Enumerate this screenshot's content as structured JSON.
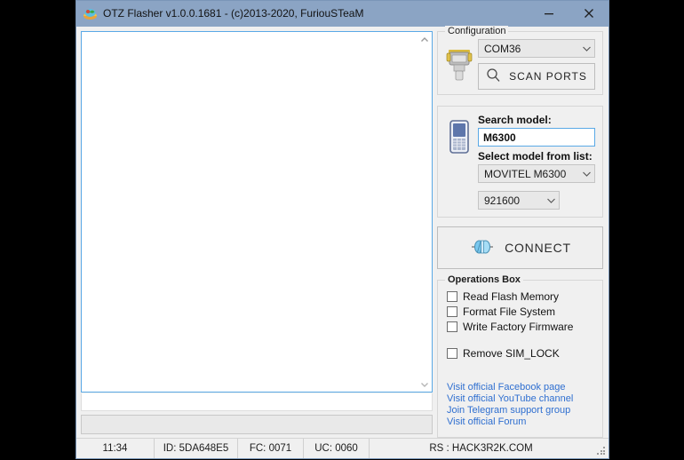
{
  "window": {
    "title": "OTZ Flasher v1.0.0.1681 - (c)2013-2020, FuriouSTeaM",
    "icon": "app-logo-icon",
    "minimize_label": "—",
    "close_label": "✕"
  },
  "log": {
    "text": "",
    "scroll_up": "⌃",
    "scroll_down": "⌄"
  },
  "configuration": {
    "group_title": "Configuration",
    "icon": "serial-port-icon",
    "port": {
      "value": "COM36",
      "options": [
        "COM36"
      ]
    },
    "scan_button": {
      "label": "SCAN PORTS",
      "icon": "magnifier-icon"
    }
  },
  "model": {
    "icon": "mobile-phone-icon",
    "search_label": "Search model:",
    "search_value": "M6300",
    "search_placeholder": "Search model",
    "list_label": "Select model from list:",
    "list_value": "MOVITEL M6300",
    "list_options": [
      "MOVITEL M6300"
    ],
    "baud_value": "921600",
    "baud_options": [
      "921600"
    ]
  },
  "connect": {
    "label": "CONNECT",
    "icon": "cable-plug-icon"
  },
  "operations": {
    "group_title": "Operations Box",
    "items": [
      {
        "label": "Read Flash Memory",
        "checked": false
      },
      {
        "label": "Format File System",
        "checked": false
      },
      {
        "label": "Write Factory Firmware",
        "checked": false
      },
      {
        "label": "Remove SIM_LOCK",
        "checked": false
      }
    ],
    "links": [
      "Visit official Facebook page",
      "Visit official YouTube channel",
      "Join Telegram support group",
      "Visit official Forum"
    ]
  },
  "statusbar": {
    "time": "11:34",
    "id": "ID: 5DA648E5",
    "fc": "FC: 0071",
    "uc": "UC: 0060",
    "rs": "RS : HACK3R2K.COM"
  },
  "colors": {
    "titlebar": "#8ba4c4",
    "window_bg": "#f0f0f0",
    "accent_focus": "#5aa9e6",
    "link": "#2f6fd0"
  }
}
